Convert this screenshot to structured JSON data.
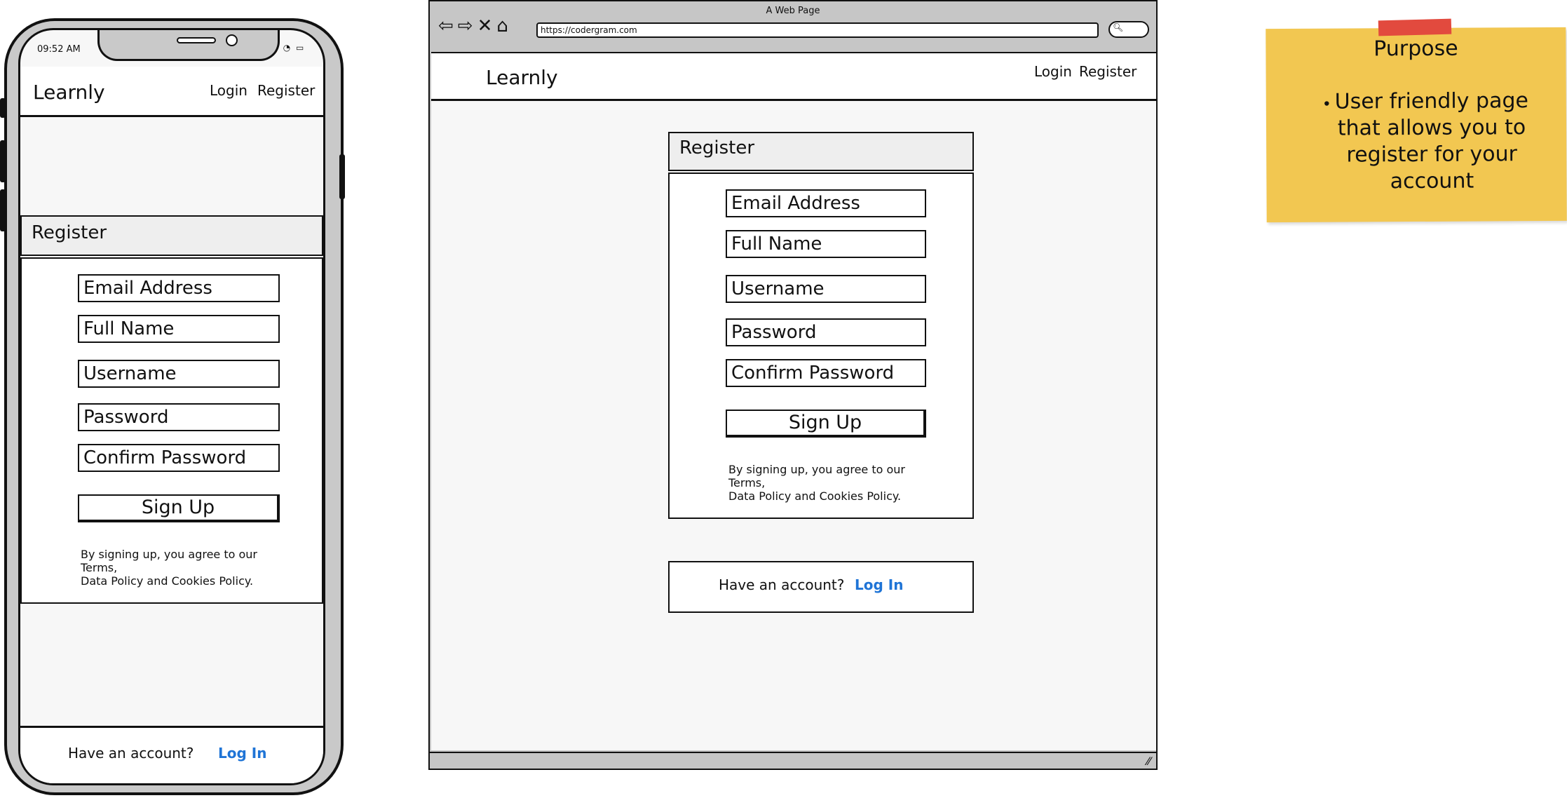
{
  "phone": {
    "status_time": "09:52 AM",
    "status_icons": "📶 ◔ ▭",
    "logo": "Learnly",
    "nav": {
      "login": "Login",
      "register": "Register"
    },
    "register_title": "Register",
    "fields": {
      "email": "Email Address",
      "full_name": "Full Name",
      "username": "Username",
      "password": "Password",
      "confirm_password": "Confirm Password"
    },
    "signup_label": "Sign Up",
    "terms_line1": "By signing up, you agree to our Terms,",
    "terms_line2": "Data Policy and Cookies Policy.",
    "footer_text": "Have an account?",
    "footer_link": "Log In"
  },
  "browser": {
    "window_title": "A Web Page",
    "url": "https://codergram.com",
    "logo": "Learnly",
    "nav": {
      "login": "Login",
      "register": "Register"
    },
    "register_title": "Register",
    "fields": {
      "email": "Email Address",
      "full_name": "Full Name",
      "username": "Username",
      "password": "Password",
      "confirm_password": "Confirm Password"
    },
    "signup_label": "Sign Up",
    "terms_line1": "By signing up, you agree to our Terms,",
    "terms_line2": "Data Policy and Cookies Policy.",
    "login_prompt": "Have an account?",
    "login_link": "Log In"
  },
  "note": {
    "title": "Purpose",
    "bullet": "User friendly page that allows you to register for your account"
  },
  "colors": {
    "link": "#1f74d6",
    "note": "#f2c751",
    "tape": "#e24a3e",
    "chrome": "#c6c6c6"
  }
}
